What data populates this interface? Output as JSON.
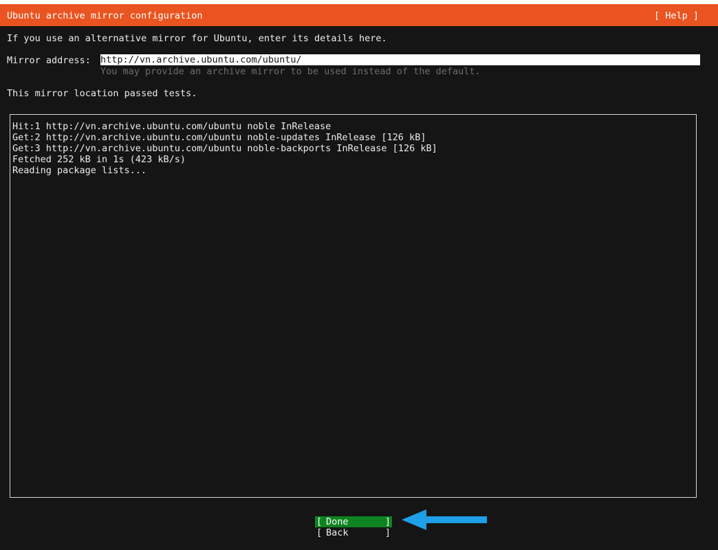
{
  "header": {
    "title": "Ubuntu archive mirror configuration",
    "help": "[ Help ]"
  },
  "intro": "If you use an alternative mirror for Ubuntu, enter its details here.",
  "mirror": {
    "label": "Mirror address:",
    "value": "http://vn.archive.ubuntu.com/ubuntu/",
    "hint": "You may provide an archive mirror to be used instead of the default."
  },
  "status": "This mirror location passed tests.",
  "log": [
    "Hit:1 http://vn.archive.ubuntu.com/ubuntu noble InRelease",
    "Get:2 http://vn.archive.ubuntu.com/ubuntu noble-updates InRelease [126 kB]",
    "Get:3 http://vn.archive.ubuntu.com/ubuntu noble-backports InRelease [126 kB]",
    "Fetched 252 kB in 1s (423 kB/s)",
    "Reading package lists..."
  ],
  "buttons": {
    "open_bracket": "[",
    "close_bracket": "]",
    "done": "Done",
    "back": "Back"
  },
  "colors": {
    "header": "#e95420",
    "background": "#151515",
    "done_button": "#0e8420",
    "arrow": "#1e9fe8"
  },
  "icons": {
    "arrow": "arrow-left-icon"
  }
}
